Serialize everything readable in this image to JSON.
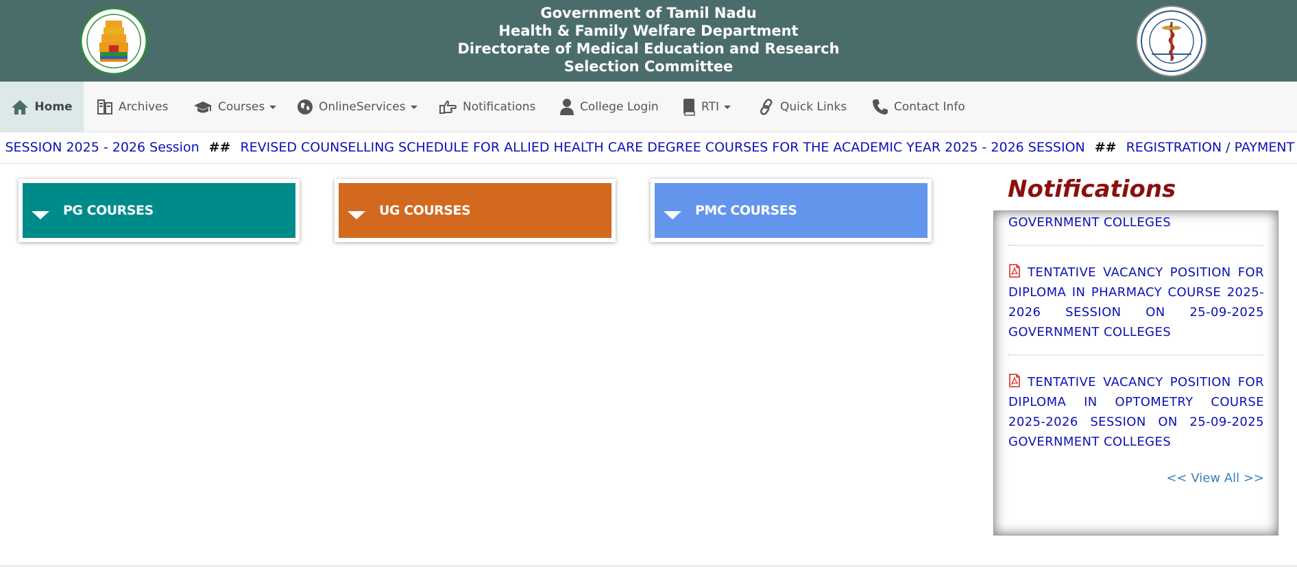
{
  "header": {
    "lines": [
      "Government of Tamil Nadu",
      "Health & Family Welfare Department",
      "Directorate of Medical Education and Research",
      "Selection Committee"
    ],
    "left_logo": "tamil-nadu-emblem",
    "right_logo": "medical-selection-seal",
    "bg_color": "#4a6d6b"
  },
  "nav": {
    "items": [
      {
        "label": "Home",
        "icon": "home-icon",
        "active": true
      },
      {
        "label": "Archives",
        "icon": "archive-icon"
      },
      {
        "label": "Courses",
        "icon": "graduation-cap-icon",
        "dropdown": true
      },
      {
        "label": "OnlineServices",
        "icon": "globe-icon",
        "dropdown": true
      },
      {
        "label": "Notifications",
        "icon": "hand-point-icon"
      },
      {
        "label": "College Login",
        "icon": "user-icon"
      },
      {
        "label": "RTI",
        "icon": "book-icon",
        "dropdown": true
      },
      {
        "label": "Quick Links",
        "icon": "link-icon"
      },
      {
        "label": "Contact Info",
        "icon": "phone-icon"
      }
    ]
  },
  "ticker": {
    "segments": [
      ") SESSION 2025 - 2026 Session",
      "REVISED COUNSELLING SCHEDULE FOR ALLIED HEALTH CARE DEGREE COURSES FOR THE ACADEMIC YEAR 2025 - 2026 SESSION",
      "REGISTRATION / PAYMENT TIME EXTE"
    ],
    "separator": "##",
    "color": "#0b10b5"
  },
  "courses": [
    {
      "label": "PG COURSES",
      "color": "#008b8b"
    },
    {
      "label": "UG COURSES",
      "color": "#d2691e"
    },
    {
      "label": "PMC COURSES",
      "color": "#6495ed"
    }
  ],
  "notifications": {
    "heading": "Notifications",
    "items": [
      {
        "text": "GOVERNMENT COLLEGES",
        "pdf": false
      },
      {
        "text": "TENTATIVE VACANCY POSITION FOR DIPLOMA IN PHARMACY COURSE 2025-2026 SESSION ON 25-09-2025 GOVERNMENT COLLEGES",
        "pdf": true
      },
      {
        "text": "TENTATIVE VACANCY POSITION FOR DIPLOMA IN OPTOMETRY COURSE 2025-2026 SESSION ON 25-09-2025 GOVERNMENT COLLEGES",
        "pdf": true
      }
    ],
    "view_all": "<< View All >>"
  }
}
